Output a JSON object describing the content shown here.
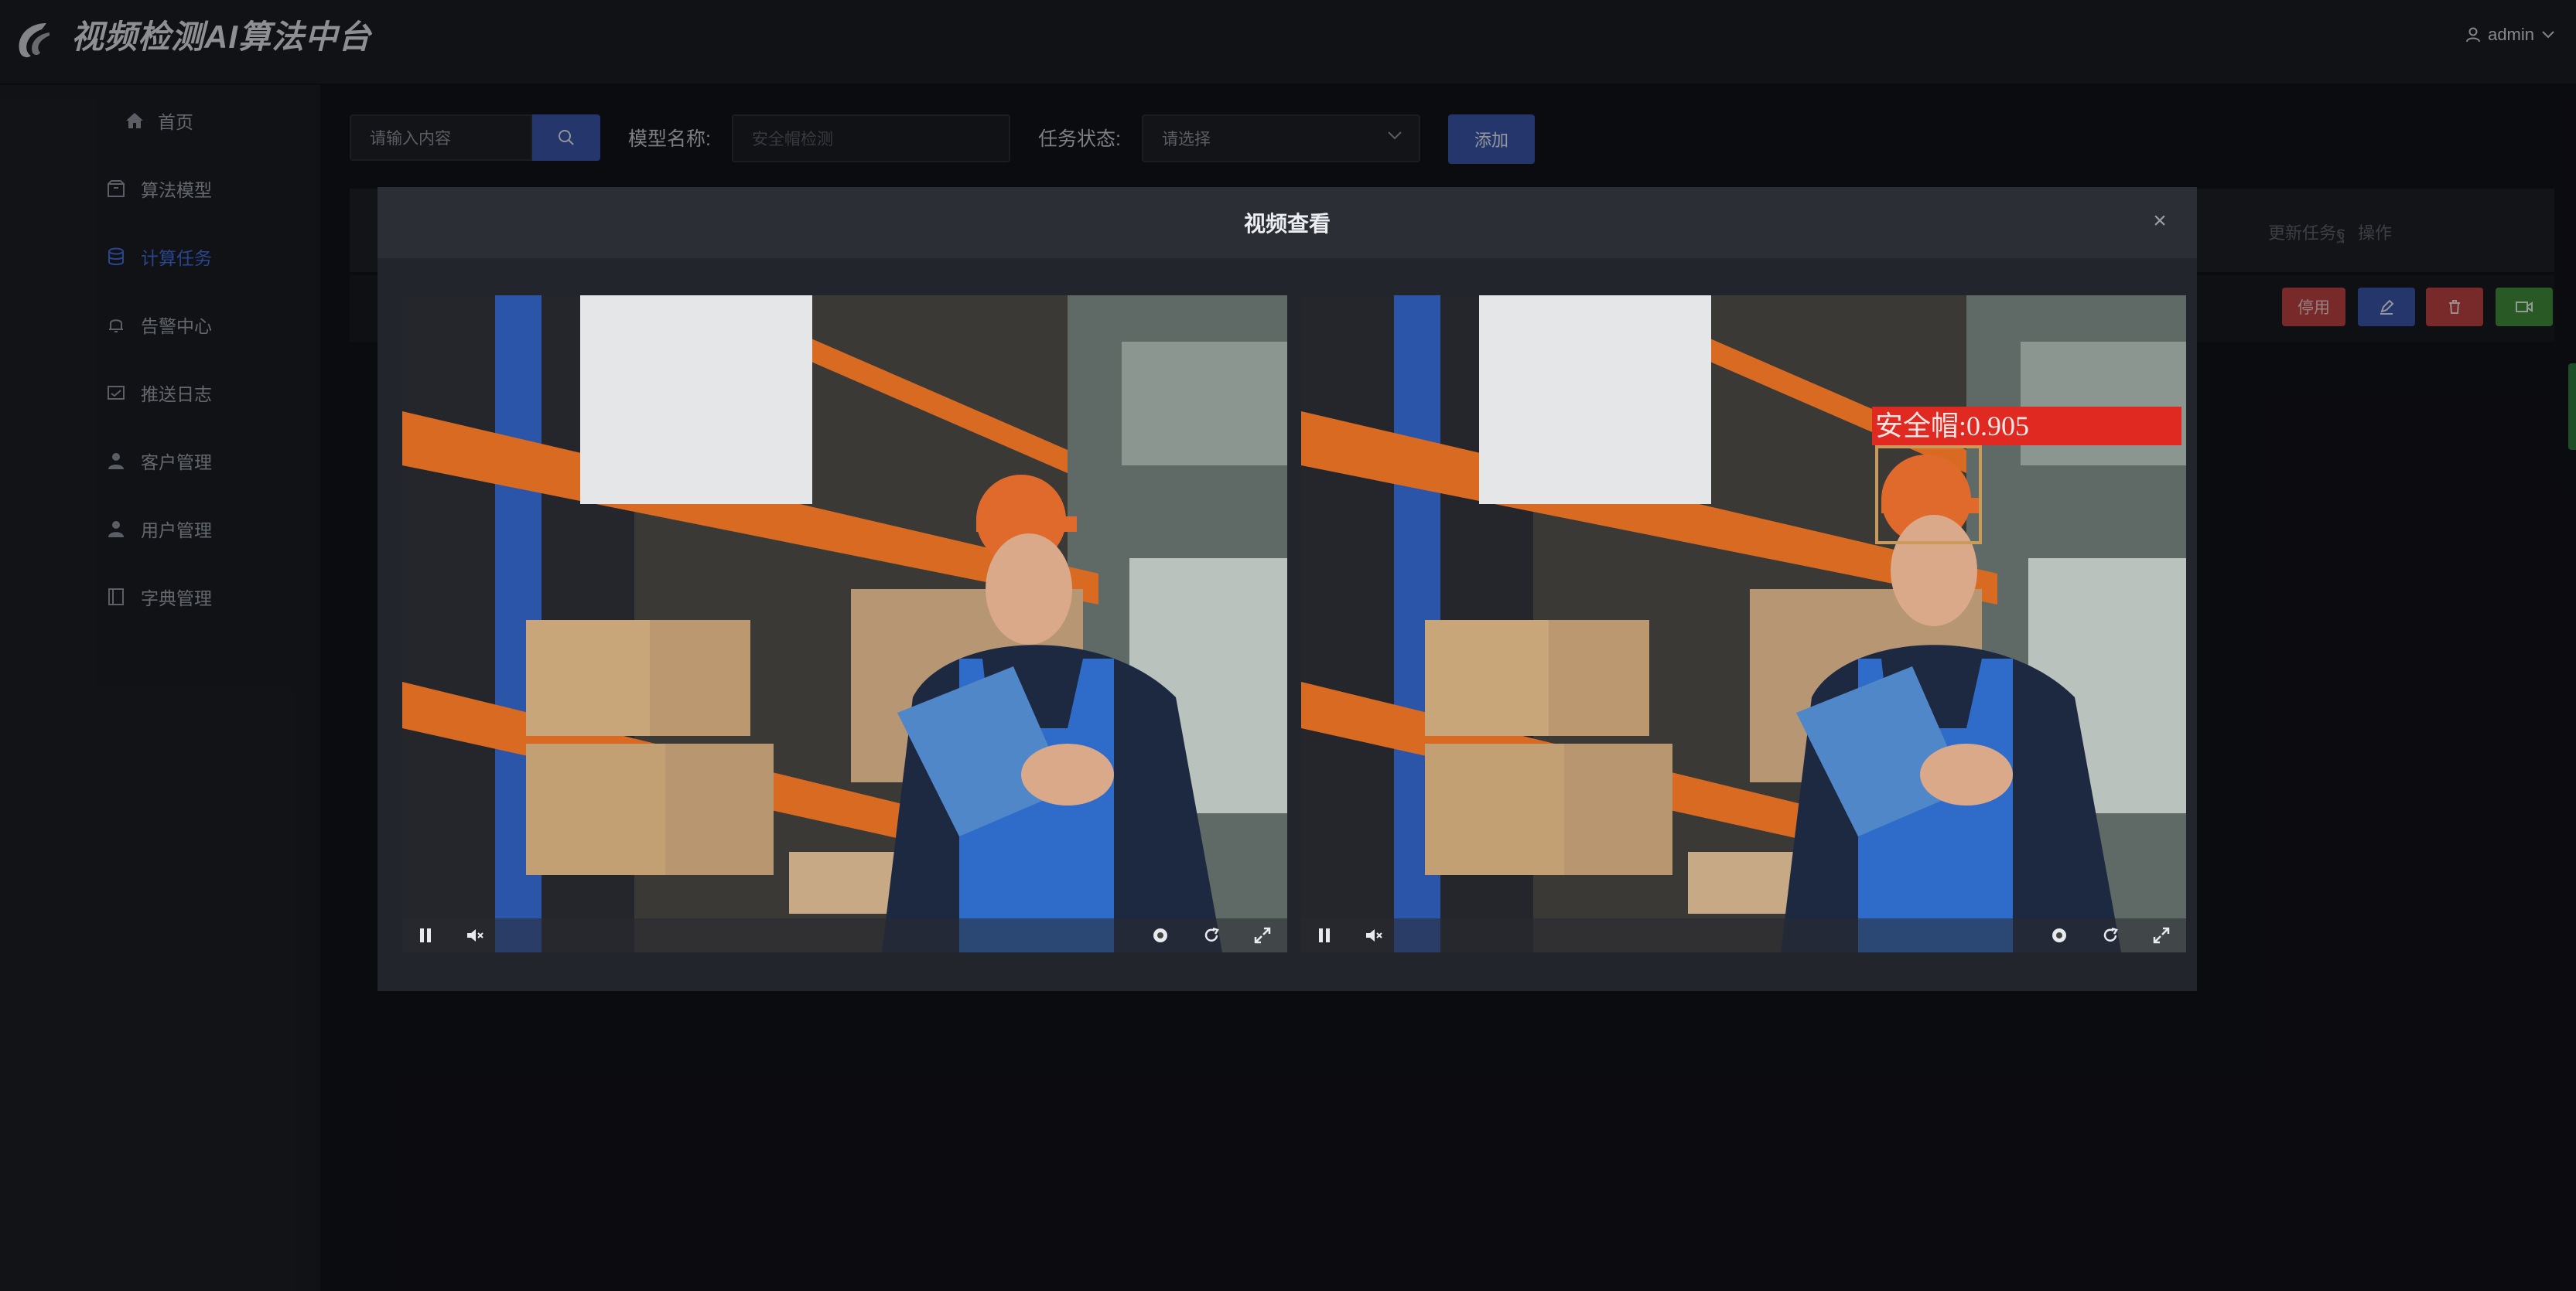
{
  "app": {
    "title": "视频检测AI算法中台",
    "user": "admin"
  },
  "sidebar": {
    "items": [
      {
        "label": "首页",
        "icon": "home-icon"
      },
      {
        "label": "算法模型",
        "icon": "box-icon"
      },
      {
        "label": "计算任务",
        "icon": "database-icon",
        "active": true
      },
      {
        "label": "告警中心",
        "icon": "bell-icon"
      },
      {
        "label": "推送日志",
        "icon": "mail-icon"
      },
      {
        "label": "客户管理",
        "icon": "person-icon"
      },
      {
        "label": "用户管理",
        "icon": "user-icon"
      },
      {
        "label": "字典管理",
        "icon": "book-icon"
      }
    ]
  },
  "filters": {
    "search_placeholder": "请输入内容",
    "model_label": "模型名称:",
    "model_placeholder": "安全帽检测",
    "status_label": "任务状态:",
    "status_placeholder": "请选择",
    "add_label": "添加"
  },
  "table": {
    "headers": [
      "更新任务ฐ",
      "操作"
    ],
    "row_actions": {
      "disable_label": "停用"
    }
  },
  "modal": {
    "title": "视频查看",
    "close": "×",
    "detection_label": "安全帽:0.905"
  },
  "colors": {
    "accent": "#3853a6",
    "active_nav": "#3f6ad8",
    "danger": "#b84040",
    "success": "#3f8a3a"
  }
}
